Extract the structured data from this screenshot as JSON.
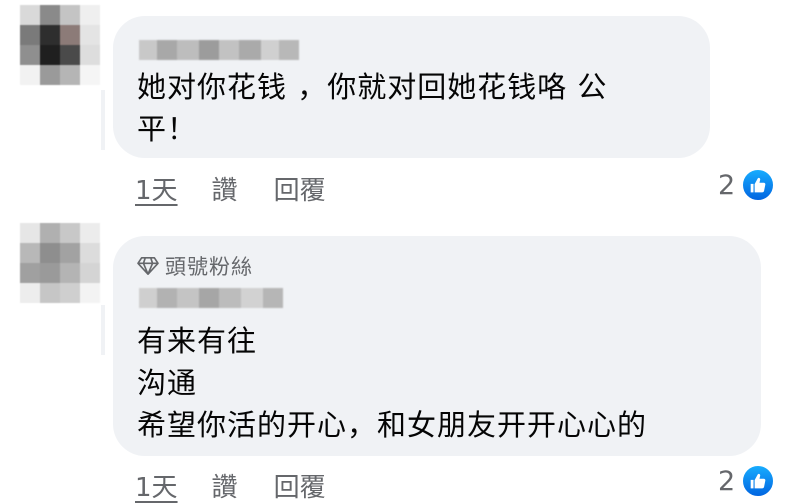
{
  "comments": [
    {
      "author_redacted": true,
      "text_lines": [
        "她对你花钱 ，你就对回她花钱咯 公",
        "平！"
      ],
      "time": "1天",
      "like_label": "讚",
      "reply_label": "回覆",
      "reaction_count": "2",
      "reaction_icon": "like-thumb-icon"
    },
    {
      "author_redacted": true,
      "badge": "頭號粉絲",
      "badge_icon": "diamond-icon",
      "text_lines": [
        "有来有往",
        "沟通",
        "希望你活的开心，和女朋友开开心心的"
      ],
      "time": "1天",
      "like_label": "讚",
      "reply_label": "回覆",
      "reaction_count": "2",
      "reaction_icon": "like-thumb-icon"
    }
  ],
  "colors": {
    "bubble": "#f0f2f5",
    "secondary_text": "#65676b",
    "like_blue": "#0866ff"
  }
}
